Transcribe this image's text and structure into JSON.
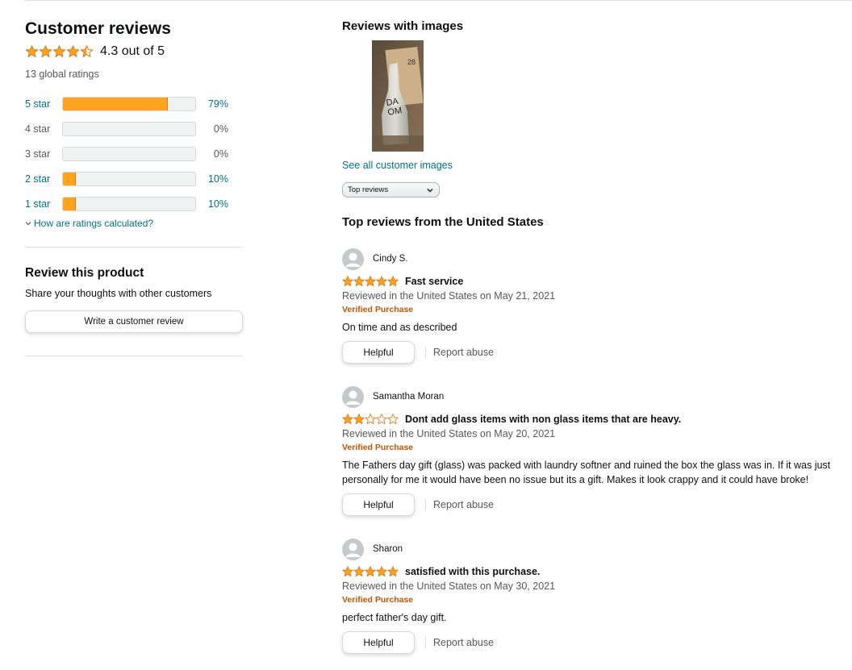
{
  "summary": {
    "title": "Customer reviews",
    "rating_value": 4.3,
    "rating_text": "4.3 out of 5",
    "global_ratings": "13 global ratings",
    "how_calculated": "How are ratings calculated?",
    "histogram": [
      {
        "label": "5 star",
        "pct": "79%",
        "value": 79,
        "link": true
      },
      {
        "label": "4 star",
        "pct": "0%",
        "value": 0,
        "link": false
      },
      {
        "label": "3 star",
        "pct": "0%",
        "value": 0,
        "link": false
      },
      {
        "label": "2 star",
        "pct": "10%",
        "value": 10,
        "link": true
      },
      {
        "label": "1 star",
        "pct": "10%",
        "value": 10,
        "link": true
      }
    ]
  },
  "review_product": {
    "title": "Review this product",
    "subtitle": "Share your thoughts with other customers",
    "button_label": "Write a customer review"
  },
  "images": {
    "title": "Reviews with images",
    "see_all": "See all customer images"
  },
  "sort": {
    "selected": "Top reviews"
  },
  "top_reviews_title": "Top reviews from the United States",
  "reviews": [
    {
      "name": "Cindy S.",
      "rating": 5,
      "title": "Fast service",
      "date": "Reviewed in the United States on May 21, 2021",
      "verified": "Verified Purchase",
      "body": "On time and as described",
      "helpful": "Helpful",
      "report": "Report abuse"
    },
    {
      "name": "Samantha Moran",
      "rating": 2,
      "title": "Dont add glass items with non glass items that are heavy.",
      "date": "Reviewed in the United States on May 20, 2021",
      "verified": "Verified Purchase",
      "body": "The Fathers day gift (glass) was packed with laundry softner and ruined the box the glass was in. If it was just personally for me it would have been no issue but its a gift. Makes it look crappy and it could have broke!",
      "helpful": "Helpful",
      "report": "Report abuse"
    },
    {
      "name": "Sharon",
      "rating": 5,
      "title": "satisfied with this purchase.",
      "date": "Reviewed in the United States on May 30, 2021",
      "verified": "Verified Purchase",
      "body": "perfect father's day gift.",
      "helpful": "Helpful",
      "report": "Report abuse"
    }
  ],
  "colors": {
    "star": "#ffa41c",
    "link": "#007185",
    "verified": "#c45500"
  }
}
